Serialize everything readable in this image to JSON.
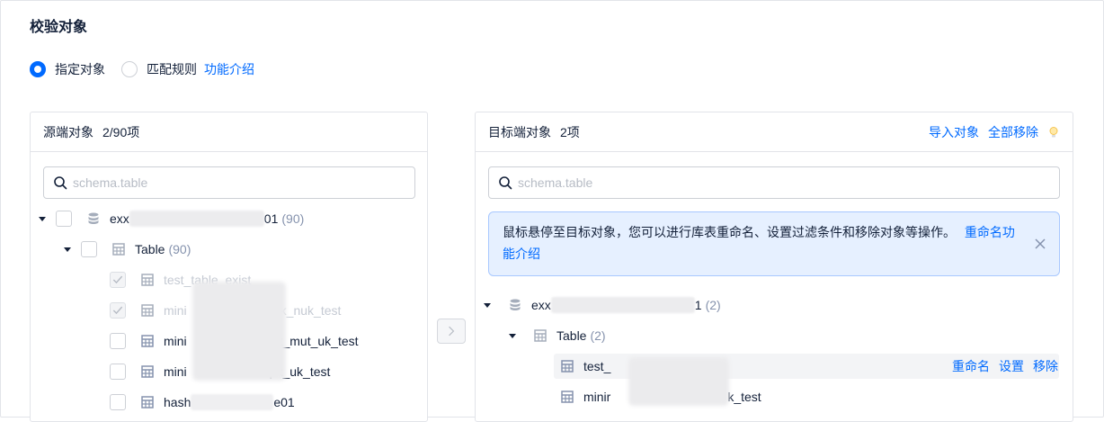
{
  "section": {
    "title": "校验对象"
  },
  "mode": {
    "option_specified": "指定对象",
    "option_rule": "匹配规则",
    "help_link": "功能介绍",
    "selected": "specified"
  },
  "source": {
    "title": "源端对象",
    "count": "2/90项",
    "search_placeholder": "schema.table",
    "db_prefix": "exx",
    "db_suffix": "01",
    "db_count": "(90)",
    "group_label": "Table",
    "group_count": "(90)",
    "tables": [
      {
        "prefix": "test_table_exist",
        "suffix": "",
        "disabled": true
      },
      {
        "prefix": "mini",
        "suffix": "k_nuk_test",
        "disabled": true
      },
      {
        "prefix": "mini",
        "suffix": "pk_mut_uk_test",
        "disabled": false
      },
      {
        "prefix": "mini",
        "suffix": "pk_uk_test",
        "disabled": false
      },
      {
        "prefix": "hash",
        "suffix": "e01",
        "disabled": false
      }
    ]
  },
  "target": {
    "title": "目标端对象",
    "count": "2项",
    "import_label": "导入对象",
    "remove_all_label": "全部移除",
    "search_placeholder": "schema.table",
    "tip_text": "鼠标悬停至目标对象，您可以进行库表重命名、设置过滤条件和移除对象等操作。",
    "tip_link": "重命名功能介绍",
    "db_prefix": "exx",
    "db_suffix": "1",
    "db_count": "(2)",
    "group_label": "Table",
    "group_count": "(2)",
    "tables": [
      {
        "prefix": "test_",
        "suffix": ""
      },
      {
        "prefix": "minir",
        "suffix": "k_test"
      }
    ],
    "row_actions": {
      "rename": "重命名",
      "settings": "设置",
      "remove": "移除"
    }
  },
  "colors": {
    "accent": "#006aff",
    "tip_bg": "#e6f0ff",
    "border": "#e2e4e9"
  }
}
